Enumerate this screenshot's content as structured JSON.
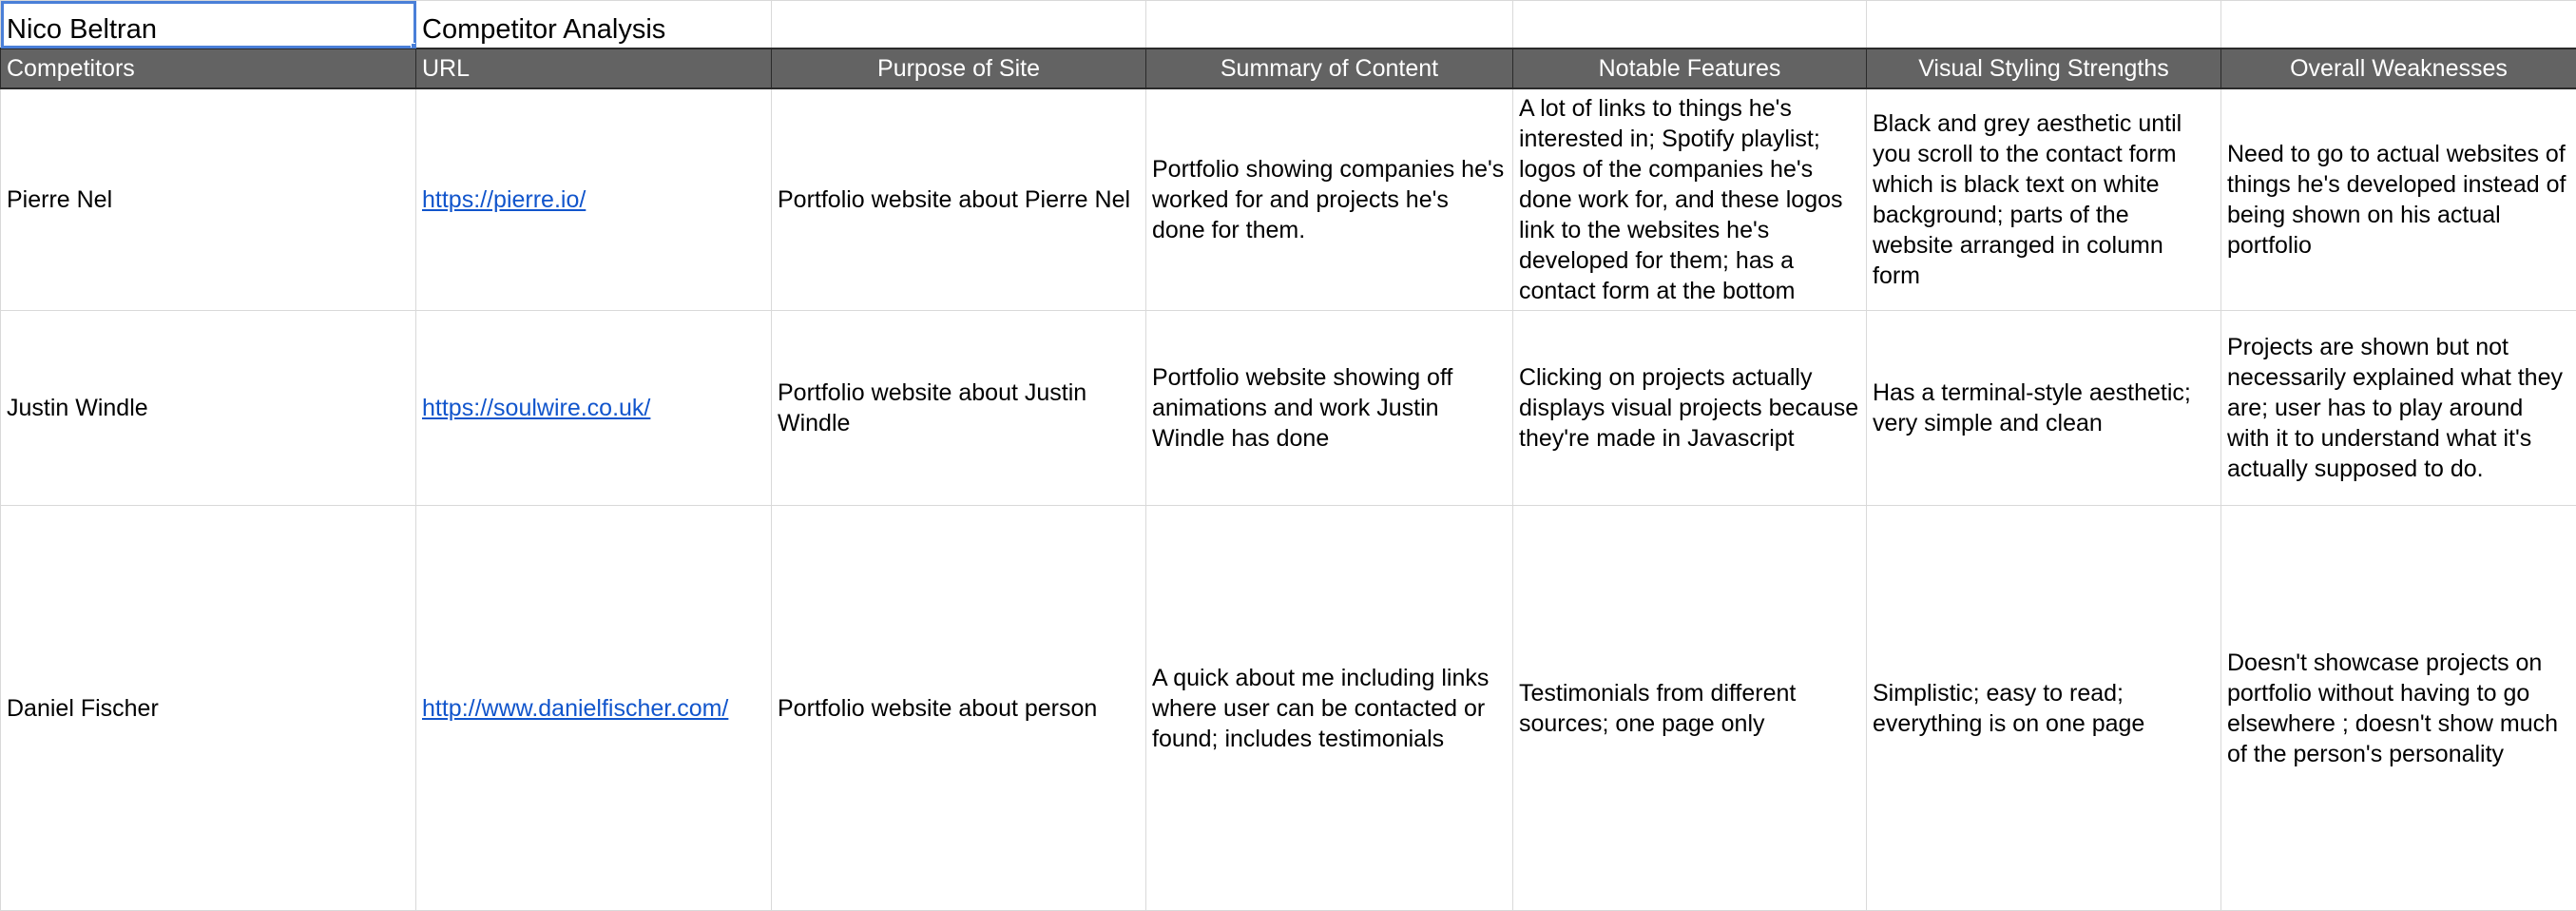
{
  "title_row": {
    "name": "Nico Beltran",
    "sheet_title": "Competitor Analysis"
  },
  "headers": [
    "Competitors",
    "URL",
    "Purpose of Site",
    "Summary of Content",
    "Notable Features",
    "Visual Styling Strengths",
    "Overall Weaknesses"
  ],
  "rows": [
    {
      "competitor": "Pierre Nel",
      "url": "https://pierre.io/",
      "purpose": "Portfolio website about Pierre Nel",
      "summary": "Portfolio showing companies he's worked for and projects he's done for them.",
      "features": "A lot of links to things he's interested in; Spotify playlist; logos of the companies he's done work for, and these logos link to the websites he's developed for them; has a contact form at the bottom",
      "styling": "Black and grey aesthetic until you scroll to the contact form which is black text on white background; parts of the website arranged in column form",
      "weaknesses": "Need to go to actual websites of things he's developed instead of being shown on his actual portfolio"
    },
    {
      "competitor": "Justin Windle",
      "url": "https://soulwire.co.uk/",
      "purpose": "Portfolio website about Justin Windle",
      "summary": "Portfolio website showing off animations and work Justin Windle has done",
      "features": "Clicking on projects actually displays visual projects because they're made in Javascript",
      "styling": "Has a terminal-style aesthetic; very simple and clean",
      "weaknesses": "Projects are shown but not necessarily explained what they are; user has to play around with it to understand what it's actually supposed to do."
    },
    {
      "competitor": "Daniel Fischer",
      "url": "http://www.danielfischer.com/",
      "purpose": "Portfolio website about person",
      "summary": "A quick about me including links where user can be contacted or found; includes testimonials",
      "features": "Testimonials from different sources; one page only",
      "styling": "Simplistic; easy to read; everything is on one page",
      "weaknesses": "Doesn't showcase projects on portfolio without having to go elsewhere ; doesn't show much of the person's personality"
    }
  ],
  "colors": {
    "header_bg": "#636363",
    "header_text": "#ffffff",
    "link": "#1155cc",
    "selection": "#4a7fd8",
    "gridline": "#d9d9d9"
  }
}
